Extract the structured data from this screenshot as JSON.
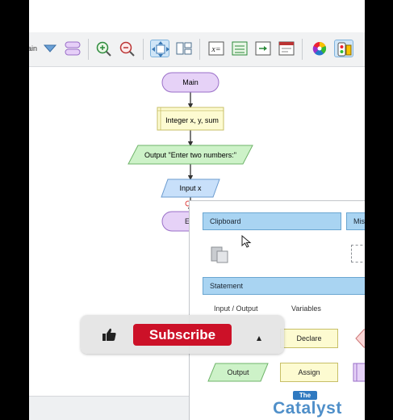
{
  "toolbar": {
    "dropdown_value": "ain",
    "buttons": [
      {
        "name": "dropdown-arrow-icon"
      },
      {
        "name": "subchart-icon"
      },
      {
        "name": "zoom-in-icon"
      },
      {
        "name": "zoom-out-icon"
      },
      {
        "name": "pan-move-icon"
      },
      {
        "name": "layout-icon"
      },
      {
        "name": "variables-x-icon"
      },
      {
        "name": "statement-icon"
      },
      {
        "name": "output-icon"
      },
      {
        "name": "console-icon"
      },
      {
        "name": "color-wheel-icon"
      },
      {
        "name": "run-settings-icon"
      }
    ]
  },
  "flowchart": {
    "start": "Main",
    "declare": "Integer x, y, sum",
    "output": "Output \"Enter two numbers:\"",
    "input": "Input x",
    "end_partial": "E"
  },
  "palette": {
    "clipboard_header": "Clipboard",
    "misc_header": "Misc",
    "statement_header": "Statement",
    "col_io": "Input / Output",
    "col_vars": "Variables",
    "declare": "Declare",
    "output": "Output",
    "assign": "Assign"
  },
  "overlay": {
    "subscribe": "Subscribe"
  },
  "logo": {
    "small": "The",
    "main": "Catalyst"
  },
  "colors": {
    "terminal_fill": "#e6d2f7",
    "declare_fill": "#fdfbd1",
    "io_fill": "#cdf2c8",
    "input_fill": "#c8e0fa",
    "palette_header": "#a9d4f2",
    "subscribe_red": "#cc1128",
    "logo_blue": "#4f8fc9"
  }
}
